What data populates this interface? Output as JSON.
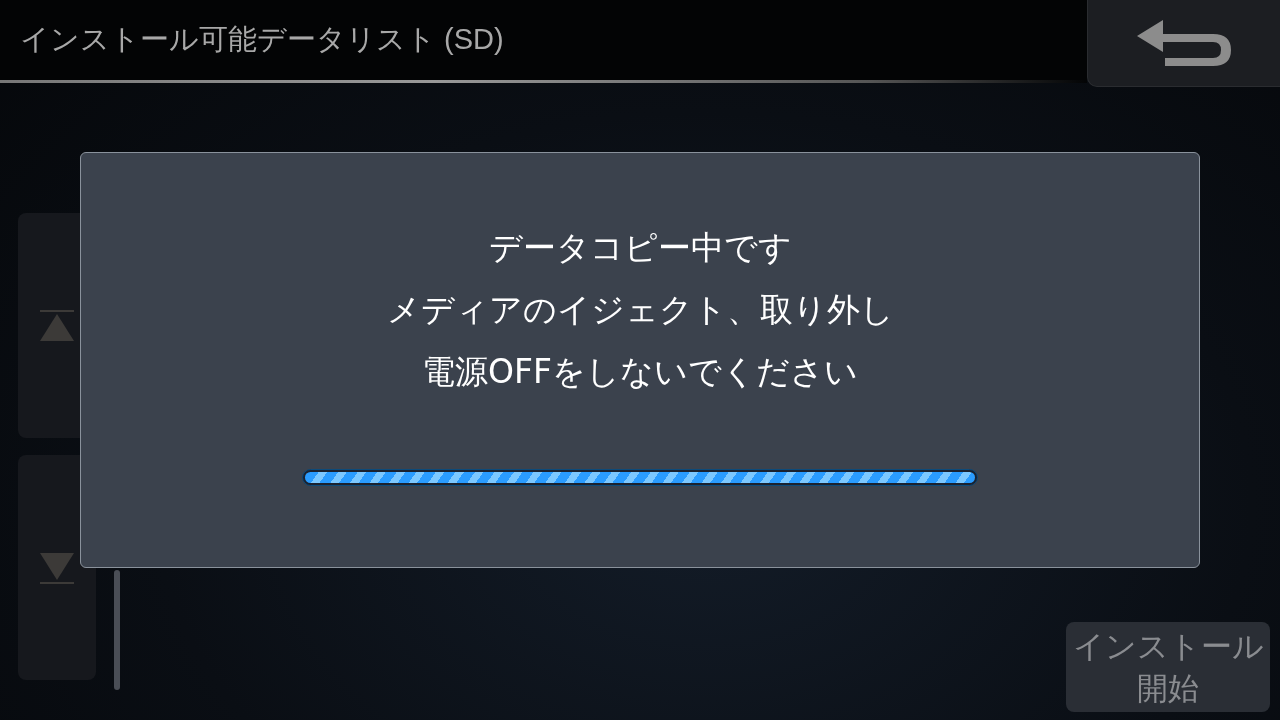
{
  "header": {
    "title": "インストール可能データリスト (SD)"
  },
  "list_controls": {
    "scroll_up_disabled": true,
    "scroll_down_disabled": true
  },
  "install_button": {
    "label_lines": [
      "インストール",
      "開始"
    ],
    "disabled": true
  },
  "dialog": {
    "message_lines": [
      "データコピー中です",
      "メディアのイジェクト、取り外し",
      "電源OFFをしないでください"
    ],
    "progress": {
      "level": 1
    }
  }
}
